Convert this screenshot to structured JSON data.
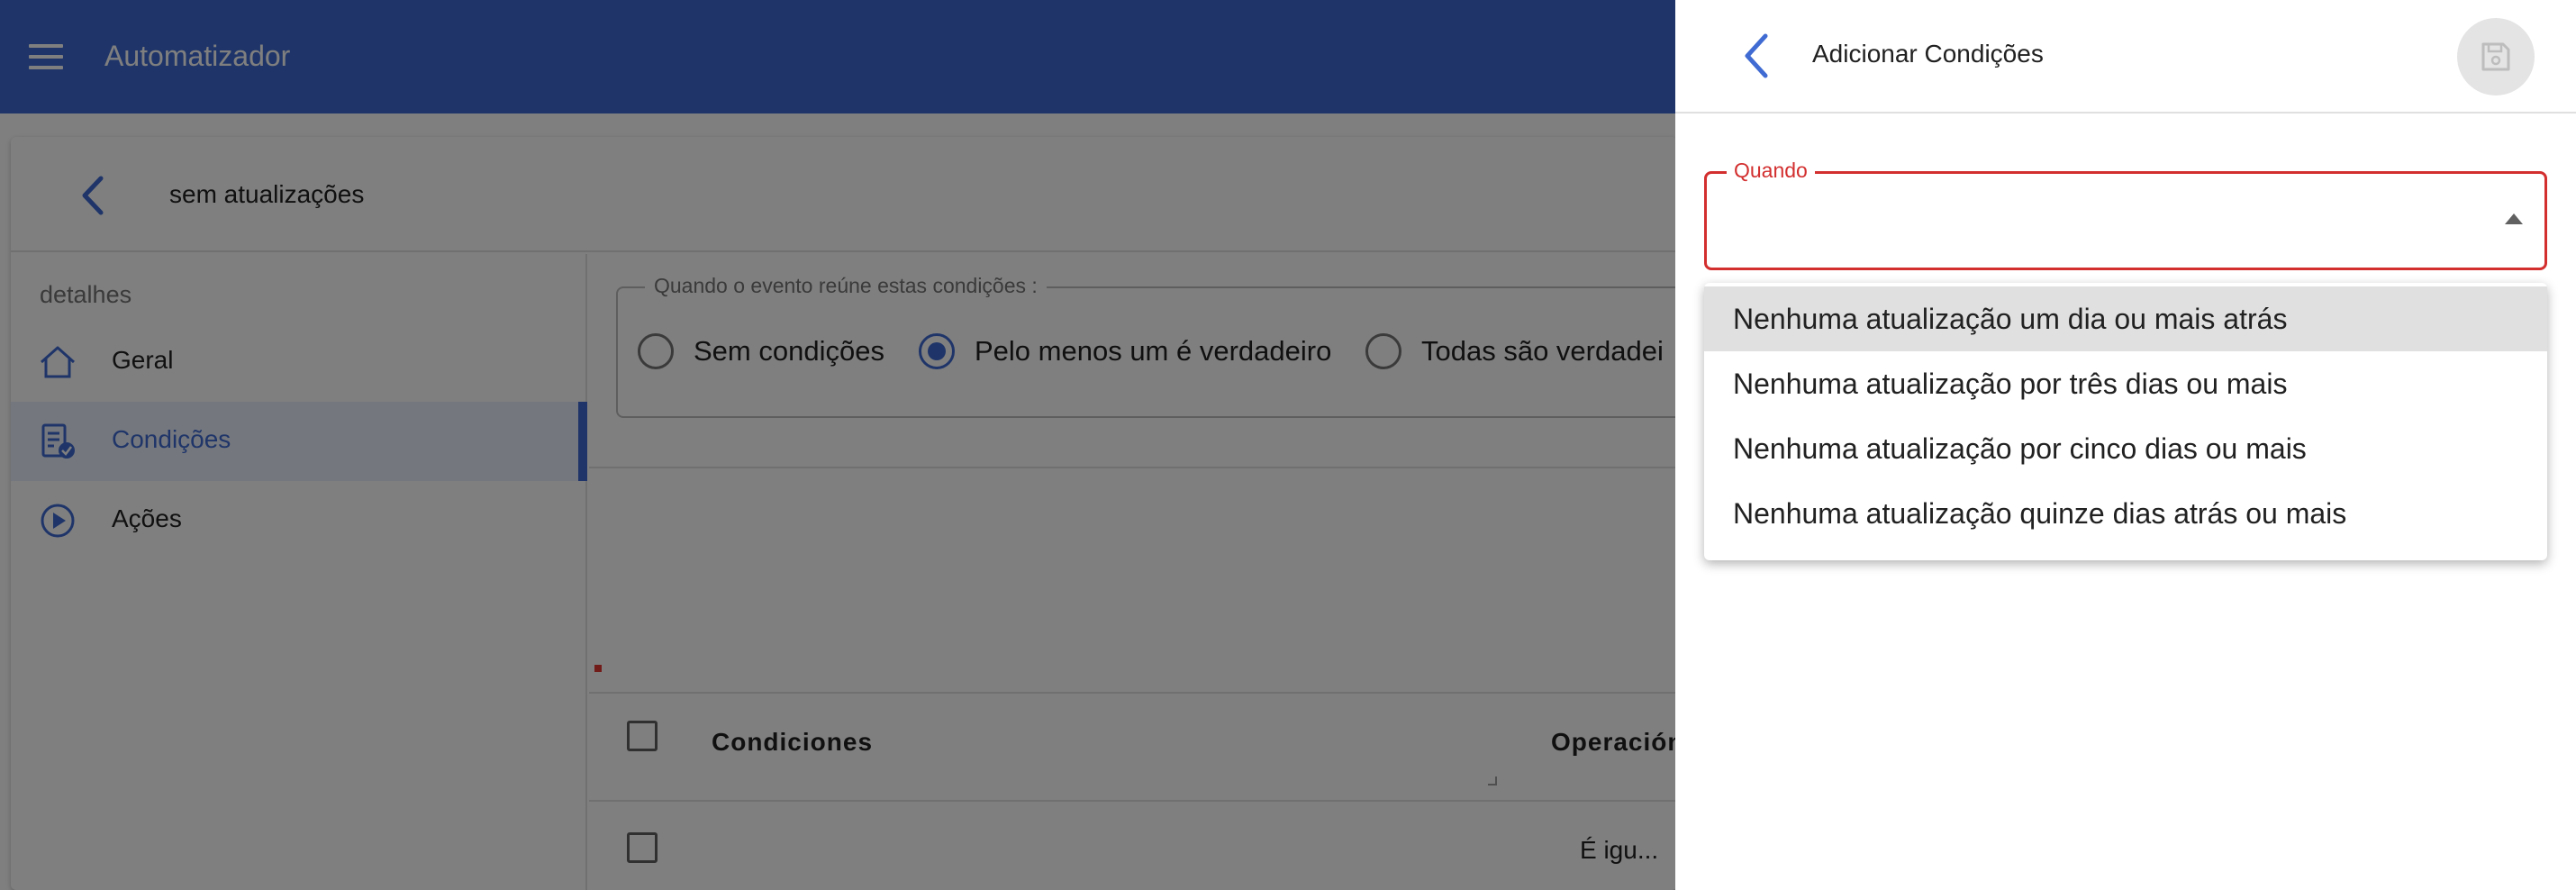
{
  "app": {
    "title": "Automatizador"
  },
  "card": {
    "title": "sem atualizações"
  },
  "sidebar": {
    "heading": "detalhes",
    "items": [
      {
        "label": "Geral",
        "icon": "home-icon",
        "active": false
      },
      {
        "label": "Condições",
        "icon": "conditions-icon",
        "active": true
      },
      {
        "label": "Ações",
        "icon": "play-circle-icon",
        "active": false
      }
    ]
  },
  "conditions": {
    "legend": "Quando o evento reúne estas condições :",
    "options": [
      {
        "label": "Sem condições",
        "checked": false
      },
      {
        "label": "Pelo menos um é verdadeiro",
        "checked": true
      },
      {
        "label": "Todas são verdadei",
        "checked": false
      }
    ]
  },
  "table": {
    "headers": [
      "Condiciones",
      "Operación"
    ],
    "rows": [
      {
        "condition": "",
        "operation": "É igu..."
      }
    ]
  },
  "panel": {
    "title": "Adicionar Condições",
    "field_label": "Quando",
    "field_value": "",
    "options": [
      "Nenhuma atualização um dia ou mais atrás",
      "Nenhuma atualização por três dias ou mais",
      "Nenhuma atualização por cinco dias ou mais",
      "Nenhuma atualização quinze dias atrás ou mais"
    ],
    "highlighted_index": 0
  },
  "colors": {
    "primary": "#3f6bd2",
    "error": "#d32f2f"
  }
}
